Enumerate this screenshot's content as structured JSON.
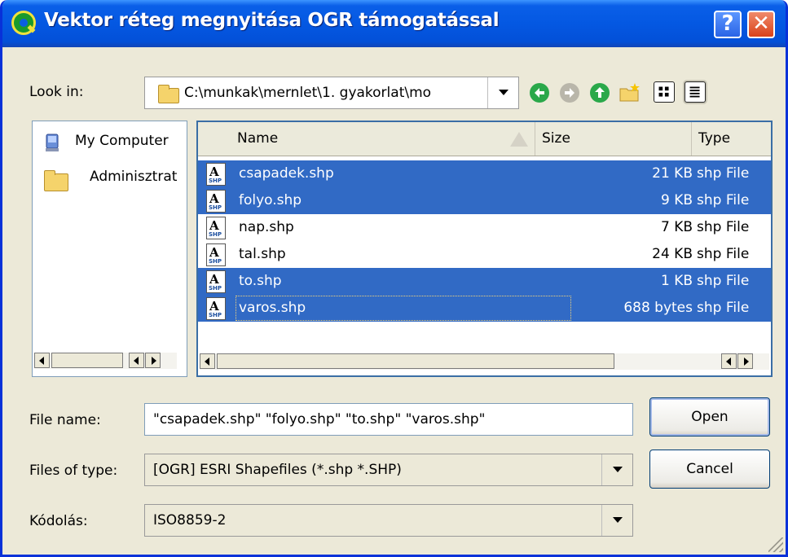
{
  "window": {
    "title": "Vektor réteg megnyitása OGR támogatással",
    "help_label": "?",
    "close_label": "✕"
  },
  "lookin": {
    "label": "Look in:",
    "path": "C:\\munkak\\mernlet\\1. gyakorlat\\mo"
  },
  "toolbar_icons": [
    "back-icon",
    "forward-icon",
    "up-icon",
    "new-folder-icon",
    "list-view-icon",
    "detail-view-icon"
  ],
  "sidebar": {
    "items": [
      {
        "label": "My Computer",
        "icon": "computer-icon"
      },
      {
        "label": "Adminisztrat",
        "icon": "folder-icon"
      }
    ]
  },
  "filelist": {
    "columns": [
      "Name",
      "Size",
      "Type"
    ],
    "rows": [
      {
        "name": "csapadek.shp",
        "size": "21 KB",
        "type": "shp File",
        "selected": true
      },
      {
        "name": "folyo.shp",
        "size": "9 KB",
        "type": "shp File",
        "selected": true
      },
      {
        "name": "nap.shp",
        "size": "7 KB",
        "type": "shp File",
        "selected": false
      },
      {
        "name": "tal.shp",
        "size": "24 KB",
        "type": "shp File",
        "selected": false
      },
      {
        "name": "to.shp",
        "size": "1 KB",
        "type": "shp File",
        "selected": true
      },
      {
        "name": "varos.shp",
        "size": "688 bytes",
        "type": "shp File",
        "selected": true
      }
    ]
  },
  "filename": {
    "label": "File name:",
    "value": "\"csapadek.shp\" \"folyo.shp\" \"to.shp\" \"varos.shp\""
  },
  "filetype": {
    "label": "Files of type:",
    "value": "[OGR] ESRI Shapefiles (*.shp *.SHP)"
  },
  "encoding": {
    "label": "Kódolás:",
    "value": "ISO8859-2"
  },
  "buttons": {
    "open": "Open",
    "cancel": "Cancel"
  },
  "colors": {
    "selection": "#316ac5",
    "titlebar": "#0458e2",
    "dialog_bg": "#ece9d8"
  }
}
